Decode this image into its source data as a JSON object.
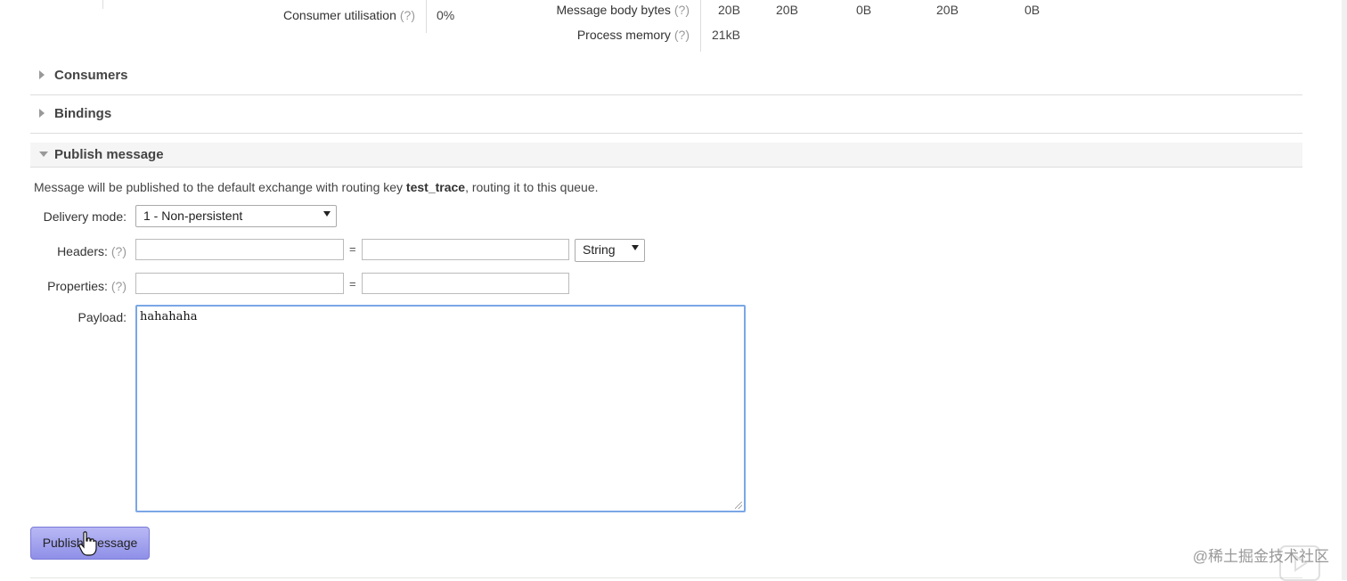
{
  "stats": {
    "left": [
      {
        "label": "Consumer utilisation",
        "help": "(?)",
        "value": "0%"
      }
    ],
    "right": [
      {
        "label": "Message body bytes",
        "help": "(?)",
        "values": [
          "20B",
          "20B",
          "0B",
          "20B",
          "0B"
        ]
      },
      {
        "label": "Process memory",
        "help": "(?)",
        "values": [
          "21kB"
        ]
      }
    ]
  },
  "sections": {
    "consumers": "Consumers",
    "bindings": "Bindings",
    "publish": "Publish message"
  },
  "publish": {
    "info_prefix": "Message will be published to the default exchange with routing key ",
    "routing_key": "test_trace",
    "info_suffix": ", routing it to this queue.",
    "delivery_mode_label": "Delivery mode:",
    "delivery_mode_value": "1 - Non-persistent",
    "headers_label": "Headers:",
    "headers_help": "(?)",
    "headers_type": "String",
    "properties_label": "Properties:",
    "properties_help": "(?)",
    "equals": "=",
    "payload_label": "Payload:",
    "payload_value": "hahahaha",
    "button_label": "Publish message"
  },
  "watermark": "@稀土掘金技术社区"
}
